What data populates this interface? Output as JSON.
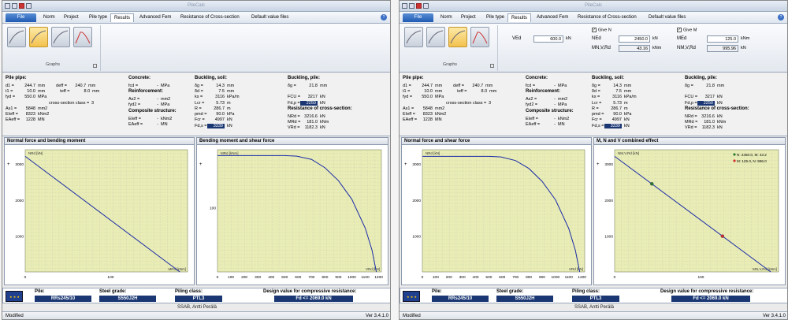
{
  "app_title": "PileCalc",
  "menu": {
    "file": "File",
    "items": [
      "Norm",
      "Project",
      "Pile type",
      "Results",
      "Advanced Fem",
      "Resistance of Cross-section",
      "Default value files"
    ],
    "active": "Results"
  },
  "ribbon": {
    "group_label": "Graphs",
    "buttons": [
      "graph-n-icon",
      "graph-m-icon",
      "graph-interaction-icon",
      "graph-displacement-icon"
    ],
    "selected_index": 1
  },
  "inputs": {
    "ved_label": "VEd",
    "ved_value": "600.0",
    "ved_unit": "kN",
    "give_n_label": "Give N",
    "give_n_checked": true,
    "ned_label": "NEd",
    "ned_value": "2450.0",
    "ned_unit": "kN",
    "mnvrd_n_label": "MN,V,Rd",
    "mnvrd_n_value": "43.16",
    "mnvrd_n_unit": "kNm",
    "give_m_label": "Give M",
    "give_m_checked": true,
    "med_label": "MEd",
    "med_value": "125.0",
    "med_unit": "kNm",
    "nmvrd_label": "NM,V,Rd",
    "nmvrd_value": "995.96",
    "nmvrd_unit": "kN"
  },
  "params": {
    "pile_pipe": {
      "heading": "Pile pipe:",
      "d1": {
        "k": "d1 =",
        "v": "244.7",
        "u": "mm"
      },
      "t1": {
        "k": "t1 =",
        "v": "10.0",
        "u": "mm"
      },
      "fyd": {
        "k": "fyd =",
        "v": "550.0",
        "u": "MPa"
      },
      "deff": {
        "k": "deff =",
        "v": "240.7",
        "u": "mm"
      },
      "teff": {
        "k": "teff =",
        "v": "8.0",
        "u": "mm"
      },
      "csc": {
        "k": "cross-section class =",
        "v": "3"
      },
      "as1": {
        "k": "As1 =",
        "v": "5848",
        "u": "mm2"
      },
      "eieff": {
        "k": "EIeff =",
        "v": "8323",
        "u": "kNm2"
      },
      "eaeff": {
        "k": "EAeff =",
        "v": "1228",
        "u": "MN"
      }
    },
    "concrete": {
      "heading": "Concrete:",
      "fcd": {
        "k": "fcd =",
        "v": "-",
        "u": "MPa"
      },
      "reinf_heading": "Reinforcement:",
      "as2": {
        "k": "As2 =",
        "v": "-",
        "u": "mm2"
      },
      "fyd2": {
        "k": "fyd2 =",
        "v": "-",
        "u": "MPa"
      },
      "comp_heading": "Composite structure:",
      "eieff": {
        "k": "EIeff =",
        "v": "-",
        "u": "kNm2"
      },
      "eaeff": {
        "k": "EAeff =",
        "v": "-",
        "u": "MN"
      }
    },
    "buckling_soil": {
      "heading": "Buckling, soil:",
      "dg": {
        "k": "δg =",
        "v": "14.3",
        "u": "mm"
      },
      "dd": {
        "k": "δd =",
        "v": "7.5",
        "u": "mm"
      },
      "ks": {
        "k": "ks =",
        "v": "3116",
        "u": "kPa/m"
      },
      "lcr": {
        "k": "Lcr =",
        "v": "5.73",
        "u": "m"
      },
      "r": {
        "k": "R =",
        "v": "286.7",
        "u": "m"
      },
      "pmd": {
        "k": "pmd =",
        "v": "90.0",
        "u": "kPa"
      },
      "fcr": {
        "k": "Fcr =",
        "v": "4997",
        "u": "kN"
      },
      "fdd": {
        "k": "Fd,s =",
        "v": "3339",
        "u": "kN"
      }
    },
    "buckling_pile": {
      "heading": "Buckling, pile:",
      "dg": {
        "k": "δg =",
        "v": "21.8",
        "u": "mm"
      },
      "fcr": {
        "k": "FCU =",
        "v": "3217",
        "u": "kN"
      },
      "fdp": {
        "k": "Fd,p =",
        "v": "2250",
        "u": "kN"
      },
      "res_heading": "Resistance of cross-section:",
      "nrd": {
        "k": "NRd =",
        "v": "3216.6",
        "u": "kN"
      },
      "mrd": {
        "k": "MRd =",
        "v": "181.0",
        "u": "kNm"
      },
      "vrd": {
        "k": "VRd =",
        "v": "1182.3",
        "u": "kN"
      }
    }
  },
  "chart_data": [
    {
      "type": "line",
      "title": "Normal force and bending moment",
      "xlabel": "MRd [kNm]",
      "ylabel": "NRd [kN]",
      "xlim": [
        0,
        190
      ],
      "ylim": [
        0,
        3400
      ],
      "x_ticks": [
        0,
        100
      ],
      "y_ticks": [
        1000,
        2000,
        3000
      ],
      "series": [
        {
          "x": [
            0,
            181
          ],
          "y": [
            3216.6,
            0
          ]
        }
      ]
    },
    {
      "type": "line",
      "title": "Bending moment and shear force",
      "xlabel": "VRd [kN]",
      "ylabel": "MRd [kNm]",
      "xlim": [
        0,
        1220
      ],
      "ylim": [
        0,
        190
      ],
      "x_ticks": [
        0,
        100,
        200,
        300,
        400,
        500,
        600,
        700,
        800,
        900,
        1000,
        1100,
        1200
      ],
      "y_ticks": [
        100
      ],
      "series": [
        {
          "x": [
            0,
            500,
            591,
            700,
            800,
            900,
            1000,
            1100,
            1150,
            1182.3
          ],
          "y": [
            181,
            181,
            180,
            175,
            162,
            142,
            113,
            68,
            34,
            0
          ]
        }
      ]
    },
    {
      "type": "line",
      "title": "Normal force and shear force",
      "xlabel": "VRd [kN]",
      "ylabel": "NRd [kN]",
      "xlim": [
        0,
        1220
      ],
      "ylim": [
        0,
        3400
      ],
      "x_ticks": [
        0,
        100,
        200,
        300,
        400,
        500,
        600,
        700,
        800,
        900,
        1000,
        1100,
        1200
      ],
      "y_ticks": [
        1000,
        2000,
        3000
      ],
      "series": [
        {
          "x": [
            0,
            500,
            591,
            700,
            800,
            900,
            1000,
            1100,
            1150,
            1182.3
          ],
          "y": [
            3216.6,
            3216.6,
            3200,
            3100,
            2880,
            2520,
            2010,
            1210,
            600,
            0
          ]
        }
      ]
    },
    {
      "type": "line",
      "title": "M, N and V combined effect",
      "xlabel": "MN,V,Rd [kNm]",
      "ylabel": "NM,V,Rd [kN]",
      "xlim": [
        0,
        190
      ],
      "ylim": [
        0,
        3400
      ],
      "x_ticks": [
        0,
        100
      ],
      "y_ticks": [
        1000,
        2000,
        3000
      ],
      "series": [
        {
          "x": [
            0,
            181
          ],
          "y": [
            3216.6,
            0
          ]
        }
      ],
      "points": [
        {
          "label": "N: 2450.0, M: 43.2",
          "x": 43.16,
          "y": 2450.0,
          "color": "#2e7d32"
        },
        {
          "label": "M: 125.0, N: 996.0",
          "x": 125.0,
          "y": 995.96,
          "color": "#d32f2f"
        }
      ]
    }
  ],
  "status": {
    "flag_label": "EU",
    "pile_label": "Pile:",
    "pile_value": "RRs245/10",
    "steel_label": "Steel grade:",
    "steel_value": "S550J2H",
    "piling_label": "Piling class:",
    "piling_value": "PTL3",
    "design_label": "Design value for compressive resistance:",
    "design_value": "Fd <= 2069.0 kN"
  },
  "footer": "SSAB, Antti Perälä",
  "bottom": {
    "left": "Modified",
    "right": "Ver 3.4.1.0"
  },
  "colors": {
    "curve": "#1a2aa8",
    "plot_bg": "#e9edb5",
    "grid": "#c9ccb0",
    "dark_value": "#1a3773"
  }
}
